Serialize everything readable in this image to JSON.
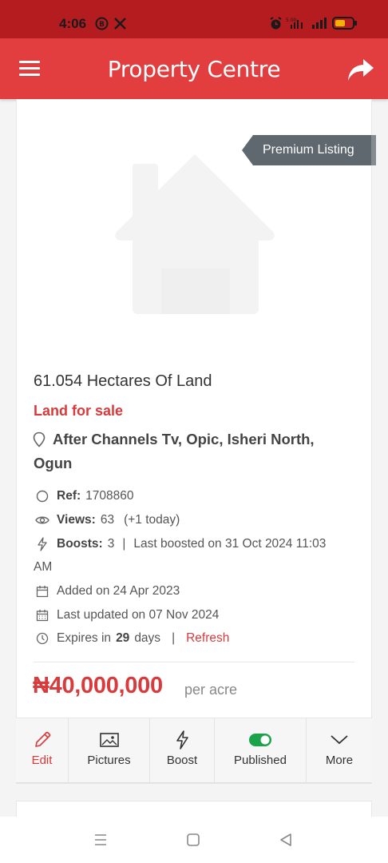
{
  "status_bar": {
    "time": "4:06",
    "icons": [
      "whatsapp-business-icon",
      "x-icon",
      "alarm-icon",
      "wifi-icon",
      "signal-icon",
      "battery-icon"
    ]
  },
  "app_bar": {
    "title": "Property Centre",
    "icons": [
      "menu-icon",
      "share-icon"
    ]
  },
  "listing": {
    "badge": "Premium Listing",
    "title": "61.054 Hectares Of Land",
    "type": "Land for sale",
    "location_line1": "After Channels Tv, Opic, Isheri North,",
    "location_line2": "Ogun",
    "ref_label": "Ref:",
    "ref_value": "1708860",
    "views_label": "Views:",
    "views_value": "63",
    "views_today": "(+1 today)",
    "boosts_label": "Boosts:",
    "boosts_value": "3",
    "separator": "|",
    "last_boosted": "Last boosted on 31 Oct 2024 11:03",
    "last_boosted_cont": "AM",
    "added": "Added on 24 Apr 2023",
    "updated": "Last updated on 07 Nov 2024",
    "expires_prefix": "Expires in",
    "expires_days": "29",
    "expires_suffix": "days",
    "refresh": "Refresh",
    "price": "₦40,000,000",
    "price_unit": "per acre"
  },
  "actions": [
    {
      "label": "Edit",
      "icon": "pencil-icon"
    },
    {
      "label": "Pictures",
      "icon": "image-icon"
    },
    {
      "label": "Boost",
      "icon": "lightning-icon"
    },
    {
      "label": "Published",
      "icon": "toggle-on-icon"
    },
    {
      "label": "More",
      "icon": "chevron-down-icon"
    }
  ],
  "colors": {
    "status_bar": "#b51c20",
    "app_bar": "#e23d3f",
    "accent": "#d93a3c",
    "badge": "#5f676f",
    "toggle_on": "#1aa34a"
  }
}
